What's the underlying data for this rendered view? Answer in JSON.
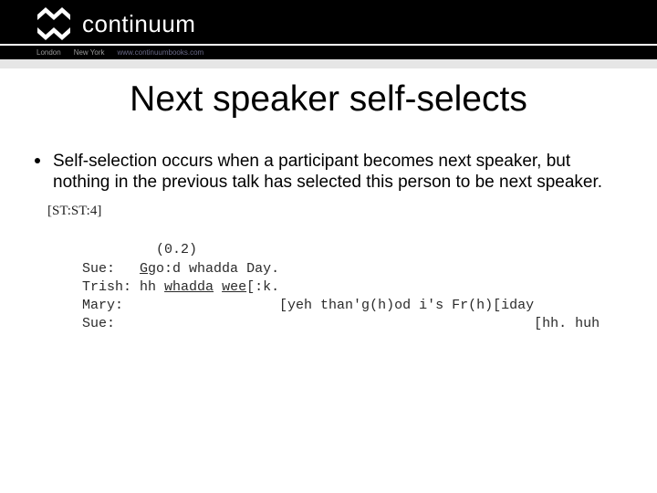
{
  "header": {
    "brand": "continuum",
    "locations": [
      "London",
      "New York"
    ],
    "url": "www.continuumbooks.com"
  },
  "slide": {
    "title": "Next speaker self-selects",
    "bullet": "Self-selection occurs when a participant becomes next speaker, but nothing in the previous talk has selected this person to be next speaker."
  },
  "transcript": {
    "id": "[ST:ST:4]",
    "pause": "(0.2)",
    "lines": {
      "sue1_speaker": "Sue:",
      "sue1_g": "G",
      "sue1_rest": "go:d whadda Day.",
      "trish_speaker": "Trish:",
      "trish_pre": "hh ",
      "trish_u": "whadda",
      "trish_mid": " ",
      "trish_wee": "wee",
      "trish_post": "[:k.",
      "mary_speaker": "Mary:",
      "mary_text": "[yeh than'g(h)od i's Fr(h)[iday",
      "sue2_speaker": "Sue:",
      "sue2_text": "[hh. huh"
    }
  }
}
